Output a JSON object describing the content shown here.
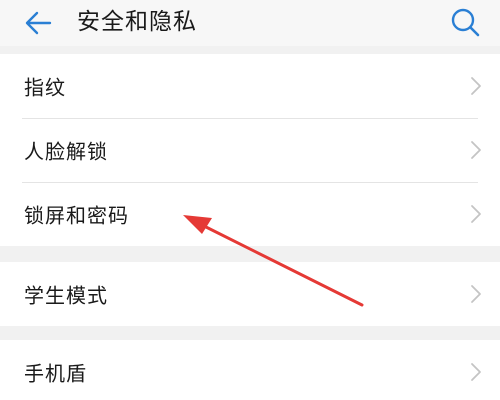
{
  "header": {
    "title": "安全和隐私",
    "back_icon": "arrow-left-icon",
    "search_icon": "search-icon"
  },
  "groups": [
    {
      "items": [
        {
          "label": "指纹"
        },
        {
          "label": "人脸解锁"
        },
        {
          "label": "锁屏和密码"
        }
      ]
    },
    {
      "items": [
        {
          "label": "学生模式"
        }
      ]
    },
    {
      "items": [
        {
          "label": "手机盾"
        }
      ]
    }
  ],
  "colors": {
    "accent": "#2a7fd4",
    "background": "#f1f1f1",
    "row_background": "#ffffff",
    "annotation_arrow": "#e53935"
  }
}
